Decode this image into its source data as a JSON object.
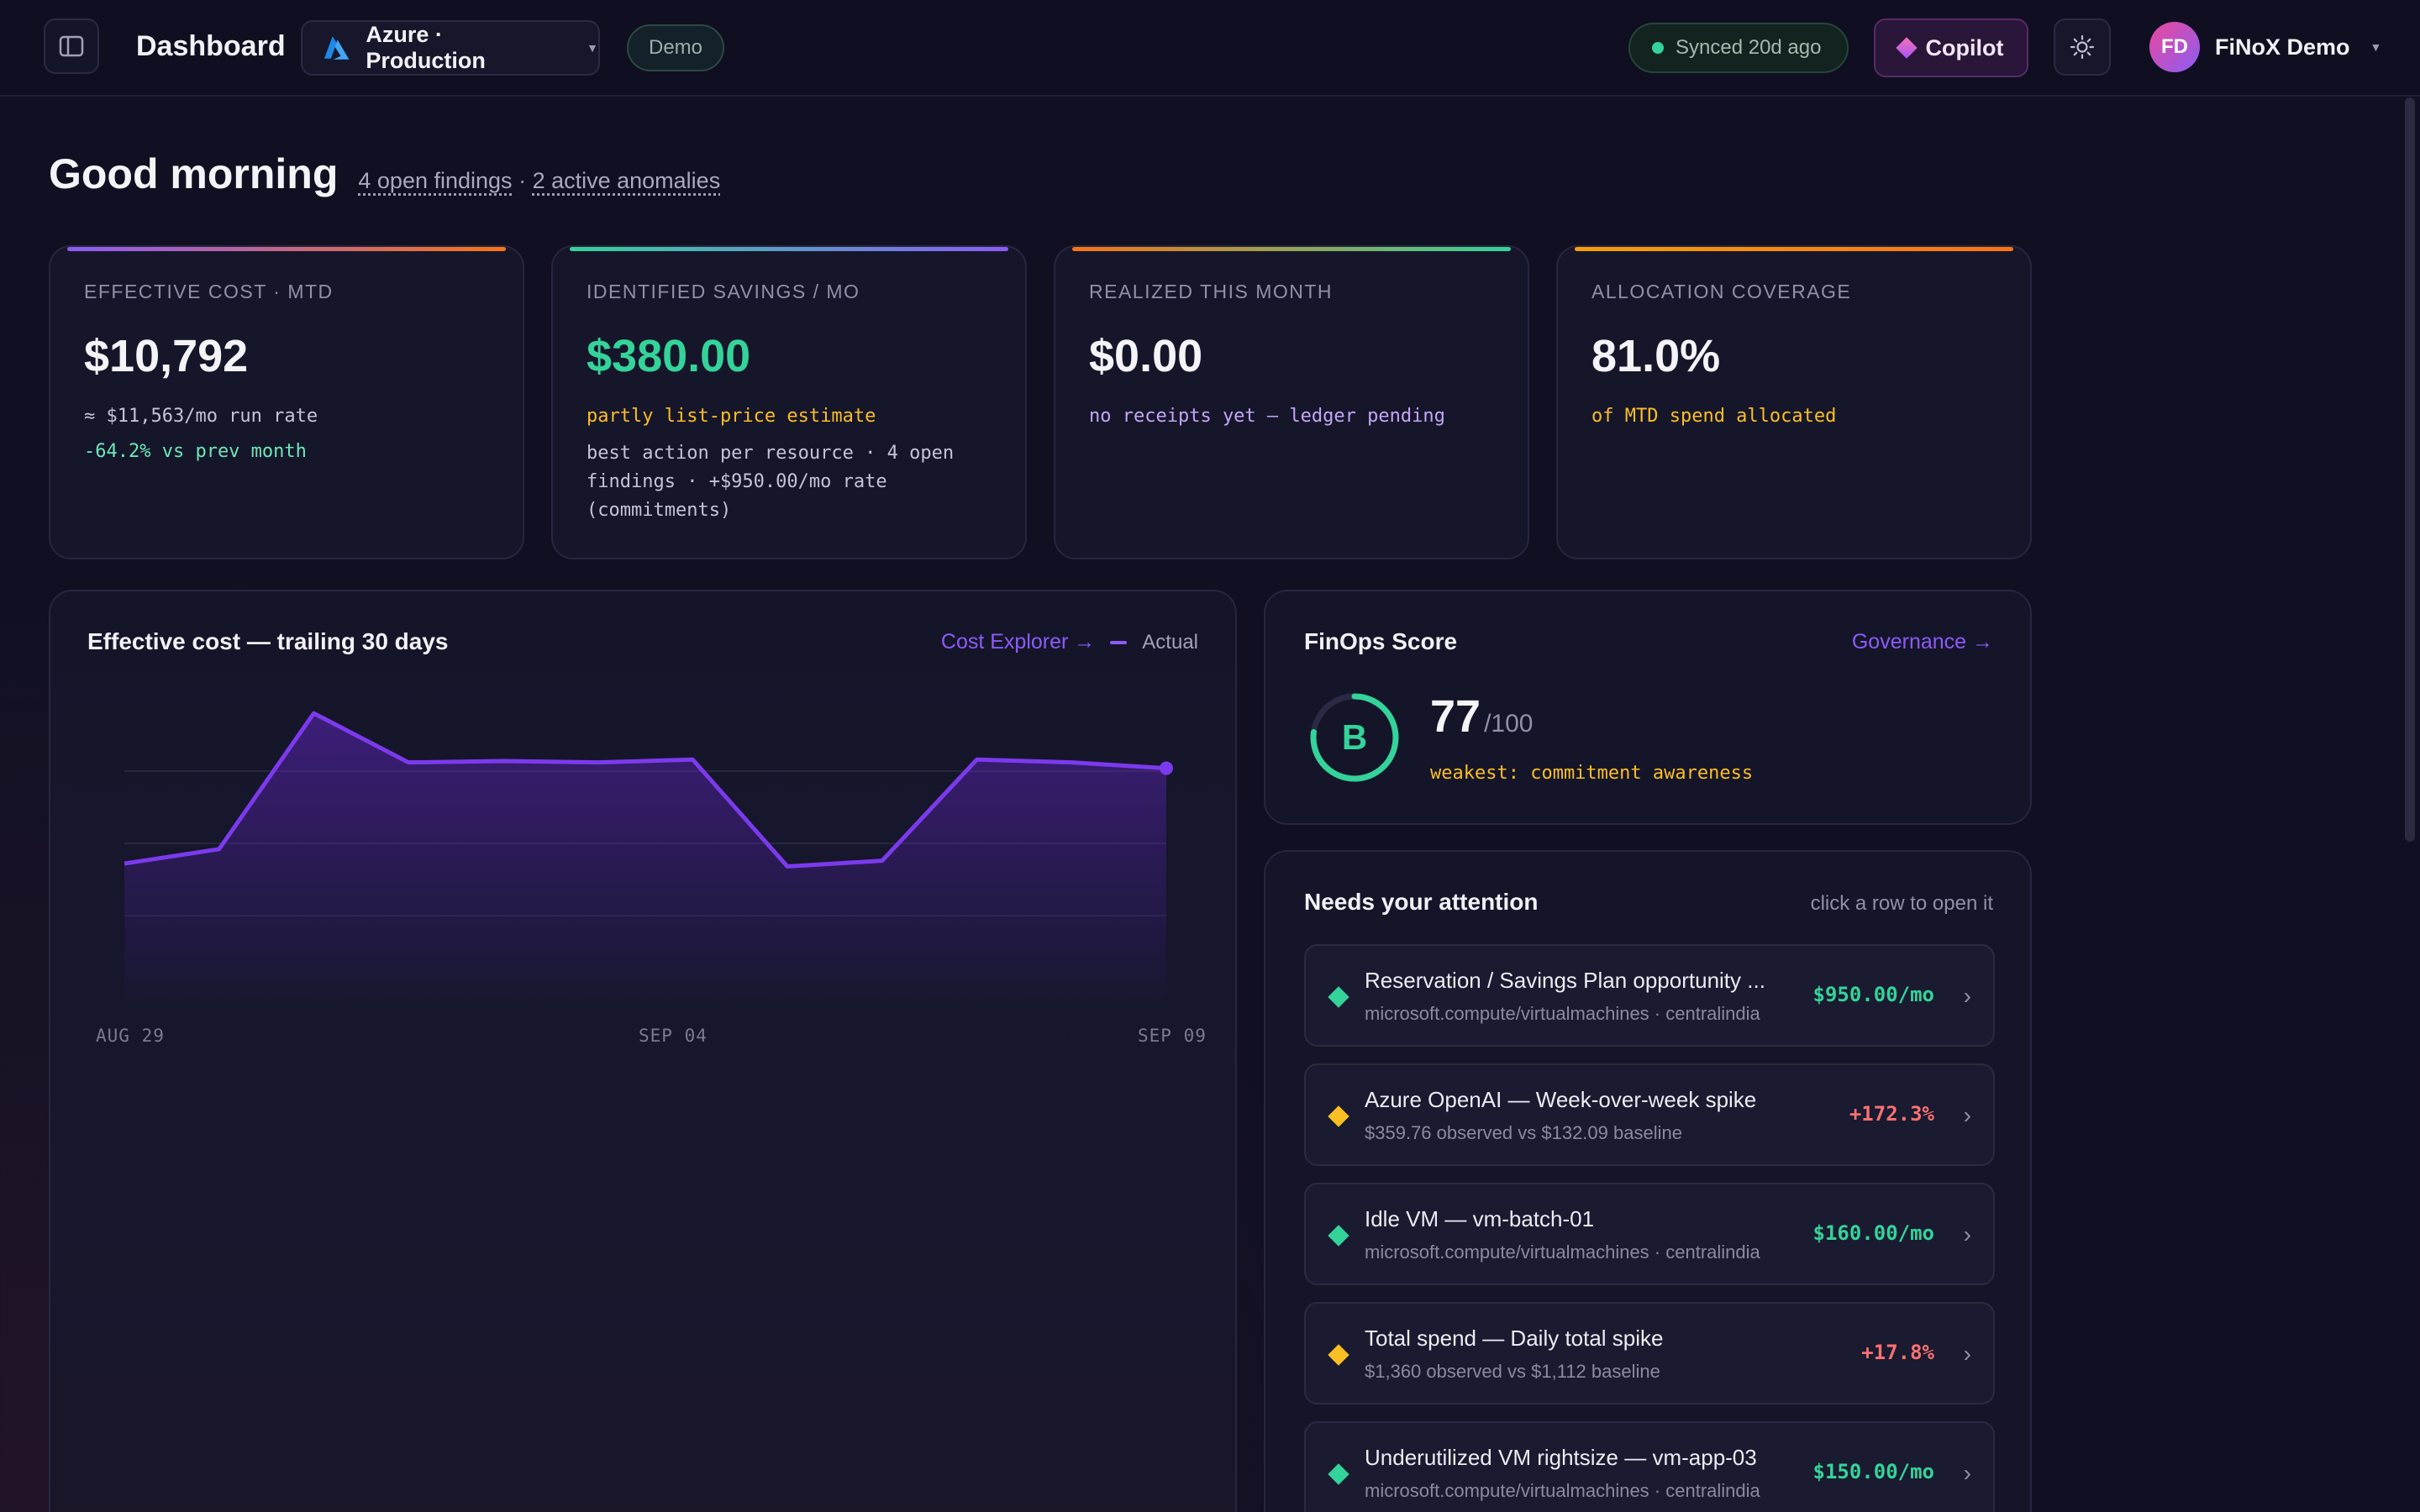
{
  "header": {
    "page_title": "Dashboard",
    "environment": "Azure · Production",
    "demo_badge": "Demo",
    "sync_status": "Synced 20d ago",
    "copilot_label": "Copilot",
    "user": {
      "initials": "FD",
      "name": "FiNoX Demo"
    }
  },
  "greeting": {
    "title": "Good morning",
    "findings_link": "4 open findings",
    "separator": "·",
    "anomalies_link": "2 active anomalies"
  },
  "kpis": [
    {
      "label": "EFFECTIVE COST · MTD",
      "value": "$10,792",
      "line1": "≈ $11,563/mo run rate",
      "line2": "-64.2% vs prev month"
    },
    {
      "label": "IDENTIFIED SAVINGS / MO",
      "value": "$380.00",
      "line1": "partly list-price estimate",
      "line2": "best action per resource · 4 open findings · +$950.00/mo rate (commitments)"
    },
    {
      "label": "REALIZED THIS MONTH",
      "value": "$0.00",
      "line1": "no receipts yet — ledger pending"
    },
    {
      "label": "ALLOCATION COVERAGE",
      "value": "81.0%",
      "line1": "of MTD spend allocated"
    }
  ],
  "cost_panel": {
    "title": "Effective cost — trailing 30 days",
    "link": "Cost Explorer →",
    "legend": "Actual"
  },
  "chart_data": {
    "type": "area",
    "title": "Effective cost — trailing 30 days",
    "x_ticks": [
      "AUG 29",
      "SEP 04",
      "SEP 09"
    ],
    "values": [
      0.43,
      0.48,
      0.95,
      0.78,
      0.785,
      0.78,
      0.79,
      0.42,
      0.44,
      0.79,
      0.78,
      0.76
    ],
    "ylim": [
      0,
      1
    ],
    "grid": true,
    "series_color": "#7c3aed"
  },
  "finops": {
    "title": "FinOps Score",
    "link": "Governance →",
    "grade": "B",
    "score": "77",
    "score_max": "/100",
    "score_value": 77,
    "weakest": "weakest: commitment awareness"
  },
  "attention": {
    "title": "Needs your attention",
    "hint": "click a row to open it",
    "rows": [
      {
        "title": "Reservation / Savings Plan opportunity ...",
        "sub": "microsoft.compute/virtualmachines · centralindia",
        "value": "$950.00/mo",
        "kind": "savings"
      },
      {
        "title": "Azure OpenAI — Week-over-week spike",
        "sub": "$359.76 observed vs $132.09 baseline",
        "value": "+172.3%",
        "kind": "anomaly"
      },
      {
        "title": "Idle VM — vm-batch-01",
        "sub": "microsoft.compute/virtualmachines · centralindia",
        "value": "$160.00/mo",
        "kind": "savings"
      },
      {
        "title": "Total spend — Daily total spike",
        "sub": "$1,360 observed vs $1,112 baseline",
        "value": "+17.8%",
        "kind": "anomaly"
      },
      {
        "title": "Underutilized VM rightsize — vm-app-03",
        "sub": "microsoft.compute/virtualmachines · centralindia",
        "value": "$150.00/mo",
        "kind": "savings"
      }
    ]
  },
  "colors": {
    "accent": "#8b5cf6",
    "green": "#34d399",
    "amber": "#fbbf24",
    "red": "#f87171",
    "lavender": "#c4a6f5"
  },
  "icons": {
    "sidebar_toggle": "sidebar-icon",
    "environment": "azure-logo-icon",
    "theme": "sun-icon",
    "row_open": "chevron-right-icon"
  }
}
